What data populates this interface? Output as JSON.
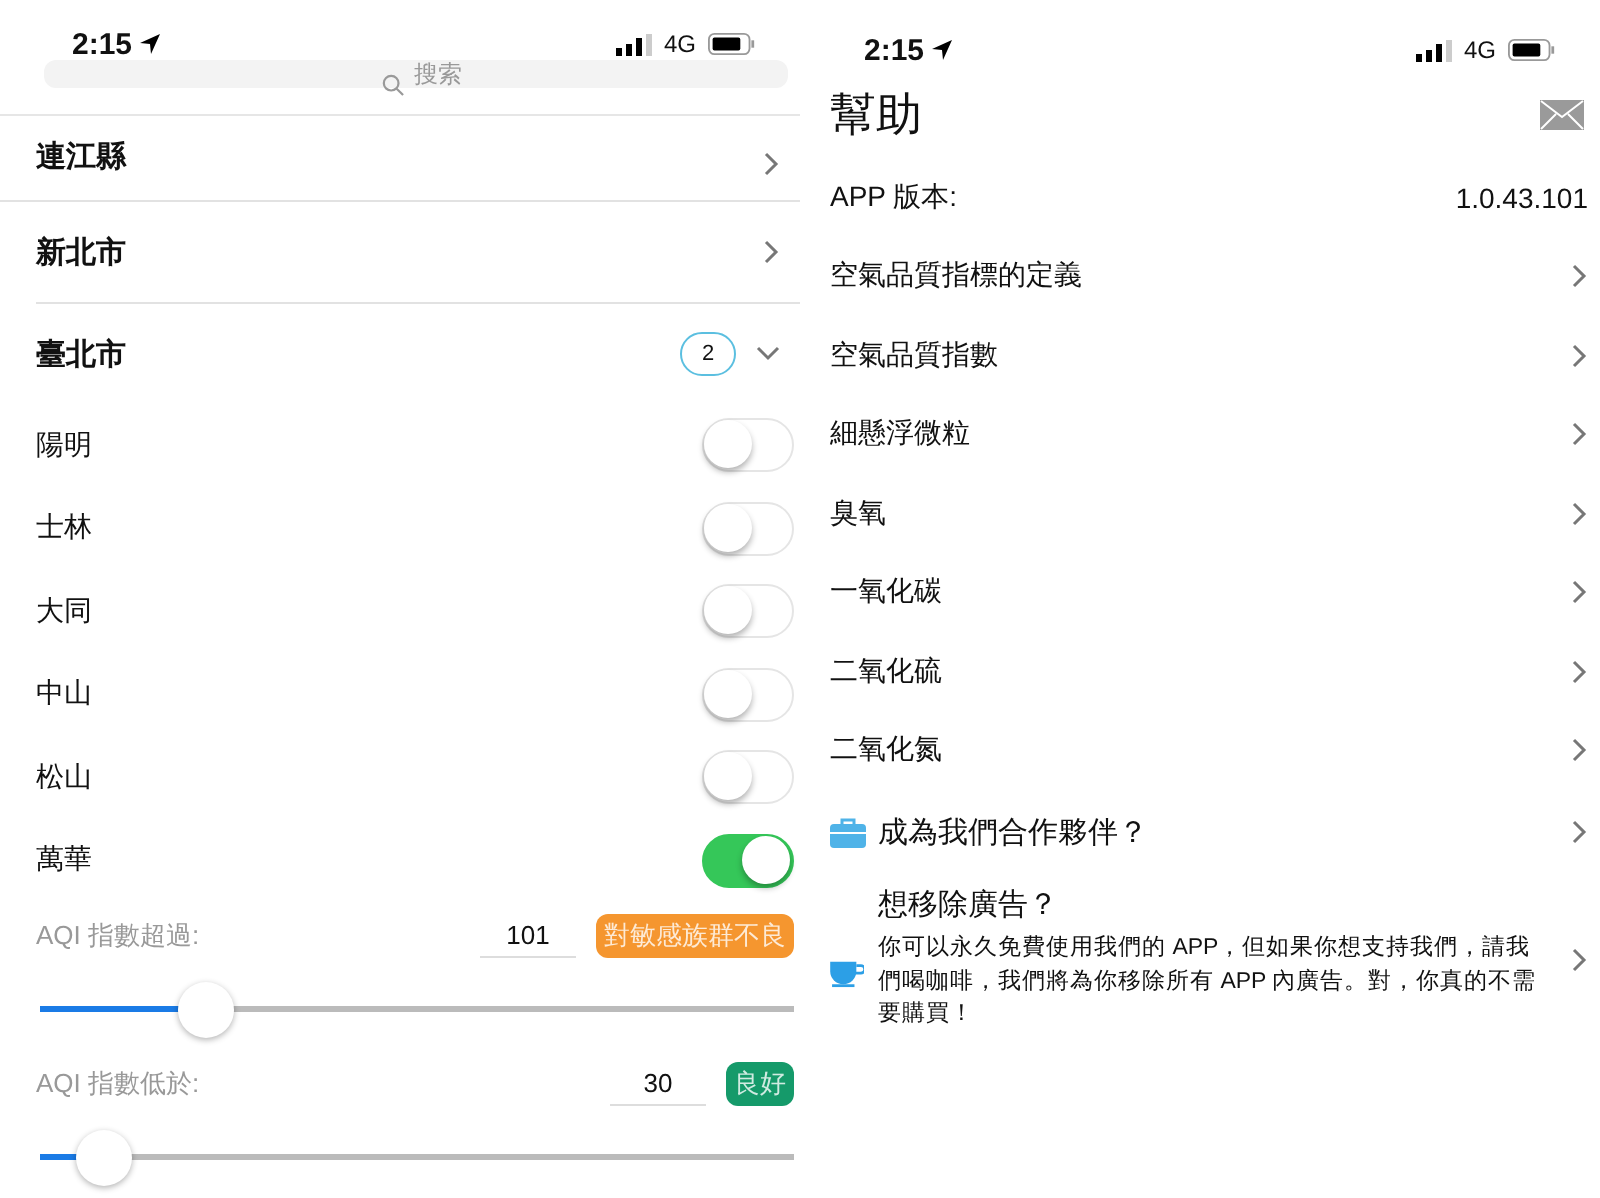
{
  "left_screen": {
    "status_bar": {
      "time": "2:15",
      "network": "4G"
    },
    "search": {
      "placeholder": "搜索"
    },
    "regions": [
      {
        "name": "連江縣",
        "kind": "link"
      },
      {
        "name": "新北市",
        "kind": "link"
      },
      {
        "name": "臺北市",
        "kind": "expandable",
        "count": "2",
        "expanded": true,
        "children": [
          {
            "name": "陽明",
            "on": false
          },
          {
            "name": "士林",
            "on": false
          },
          {
            "name": "大同",
            "on": false
          },
          {
            "name": "中山",
            "on": false
          },
          {
            "name": "松山",
            "on": false
          },
          {
            "name": "萬華",
            "on": true
          }
        ]
      }
    ],
    "thresholds": [
      {
        "label": "AQI 指數超過:",
        "value": "101",
        "tag": "對敏感族群不良",
        "color": "#f5962f",
        "level": 0.22
      },
      {
        "label": "AQI 指數低於:",
        "value": "30",
        "tag": "良好",
        "color": "#159a6a",
        "level": 0.085
      }
    ]
  },
  "right_screen": {
    "status_bar": {
      "time": "2:15",
      "network": "4G"
    },
    "title": "幫助",
    "version": {
      "label": "APP 版本:",
      "value": "1.0.43.101"
    },
    "topics": [
      "空氣品質指標的定義",
      "空氣品質指數",
      "細懸浮微粒",
      "臭氧",
      "一氧化碳",
      "二氧化硫",
      "二氧化氮"
    ],
    "extras": [
      {
        "kind": "partner",
        "title": "成為我們合作夥伴？"
      },
      {
        "kind": "coffee",
        "title": "想移除廣告？",
        "text": "你可以永久免費使用我們的 APP，但如果你想支持我們，請我們喝咖啡，我們將為你移除所有 APP 內廣告。對，你真的不需要購買！"
      }
    ]
  }
}
